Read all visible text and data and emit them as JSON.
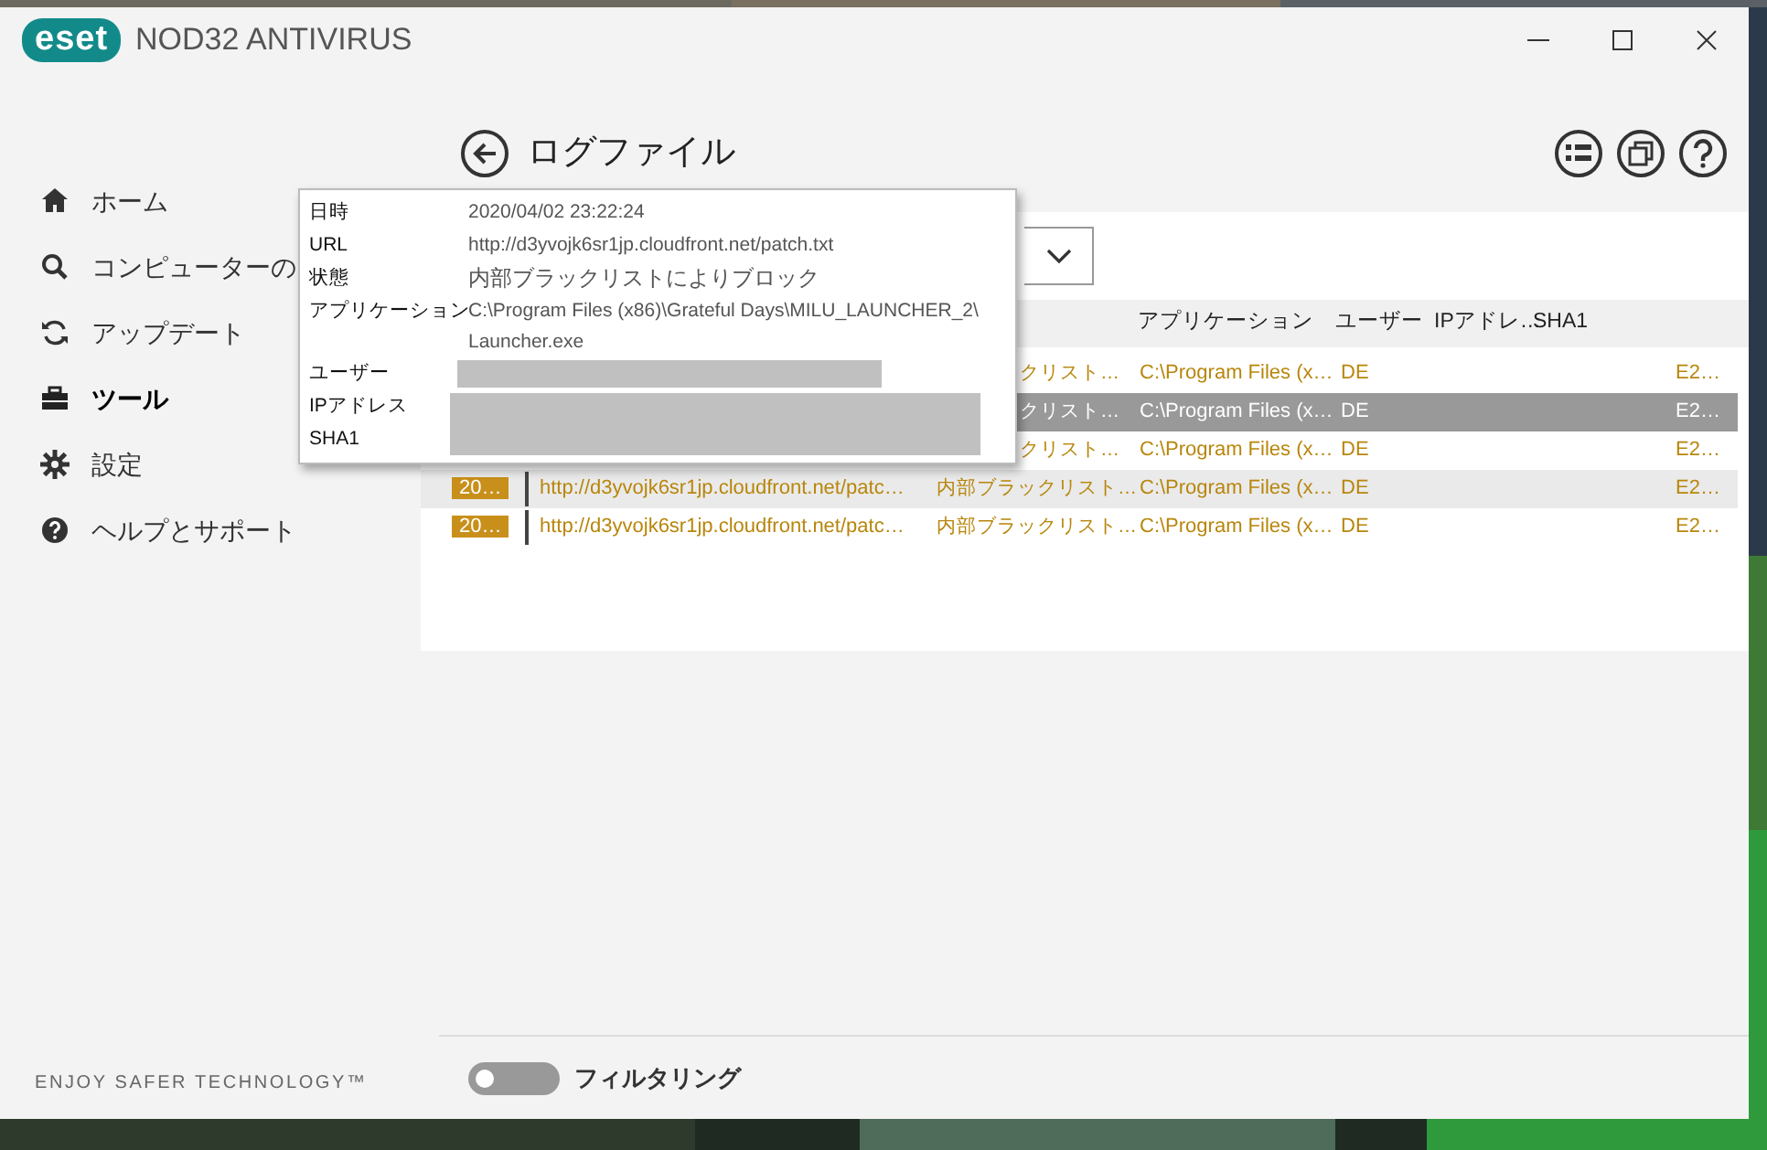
{
  "app": {
    "logo": "eset",
    "title": "NOD32 ANTIVIRUS"
  },
  "sidebar": {
    "items": [
      {
        "label": "ホーム",
        "selected": false
      },
      {
        "label": "コンピューターの",
        "selected": false
      },
      {
        "label": "アップデート",
        "selected": false
      },
      {
        "label": "ツール",
        "selected": true
      },
      {
        "label": "設定",
        "selected": false
      },
      {
        "label": "ヘルプとサポート",
        "selected": false
      }
    ],
    "tagline": "ENJOY SAFER TECHNOLOGY™"
  },
  "page": {
    "title": "ログファイル"
  },
  "table": {
    "columns": [
      "アプリケーション",
      "ユーザー",
      "IPアドレ…",
      "SHA1"
    ],
    "rows": [
      {
        "date": "",
        "url": "",
        "status": "クリスト…",
        "app": "C:\\Program Files (x…",
        "user": "DE",
        "sha1": "E2…",
        "selected": false,
        "hovered": false
      },
      {
        "date": "",
        "url": "",
        "status": "クリスト…",
        "app": "C:\\Program Files (x…",
        "user": "DE",
        "sha1": "E2…",
        "selected": true,
        "hovered": false
      },
      {
        "date": "",
        "url": "",
        "status": "クリスト…",
        "app": "C:\\Program Files (x…",
        "user": "DE",
        "sha1": "E2…",
        "selected": false,
        "hovered": false
      },
      {
        "date": "20…",
        "url": "http://d3yvojk6sr1jp.cloudfront.net/patc…",
        "status": "内部ブラックリスト…",
        "app": "C:\\Program Files (x…",
        "user": "DE",
        "sha1": "E2…",
        "selected": false,
        "hovered": true
      },
      {
        "date": "20…",
        "url": "http://d3yvojk6sr1jp.cloudfront.net/patc…",
        "status": "内部ブラックリスト…",
        "app": "C:\\Program Files (x…",
        "user": "DE",
        "sha1": "E2…",
        "selected": false,
        "hovered": false
      }
    ]
  },
  "tooltip": {
    "rows": [
      {
        "label": "日時",
        "kind": "text",
        "lines": [
          "2020/04/02 23:22:24"
        ]
      },
      {
        "label": "URL",
        "kind": "text",
        "lines": [
          "http://d3yvojk6sr1jp.cloudfront.net/patch.txt"
        ]
      },
      {
        "label": "状態",
        "kind": "text",
        "lines": [
          "内部ブラックリストによりブロック"
        ]
      },
      {
        "label": "アプリケーション",
        "kind": "text",
        "lines": [
          "C:\\Program Files (x86)\\Grateful Days\\MILU_LAUNCHER_2\\",
          "Launcher.exe"
        ]
      },
      {
        "label": "ユーザー",
        "kind": "redacted"
      },
      {
        "label": "IPアドレス",
        "kind": "redacted_start"
      },
      {
        "label": "SHA1",
        "kind": "redacted_end"
      }
    ]
  },
  "filter": {
    "label": "フィルタリング",
    "on": false
  }
}
